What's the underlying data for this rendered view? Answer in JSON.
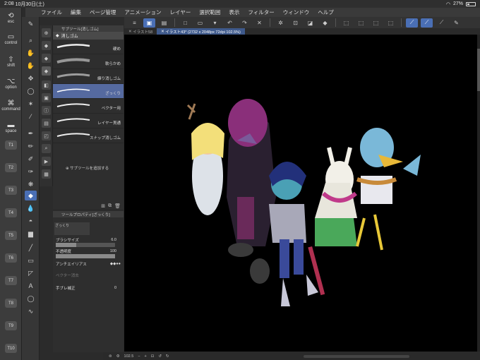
{
  "status": {
    "time": "2:08",
    "date": "10月30日(土)",
    "battery": "27%",
    "battery_level": 0.27
  },
  "menu": [
    "ファイル",
    "編集",
    "ページ管理",
    "アニメーション",
    "レイヤー",
    "選択範囲",
    "表示",
    "フィルター",
    "ウィンドウ",
    "ヘルプ"
  ],
  "edge": {
    "esc": "esc",
    "control": "control",
    "shift": "shift",
    "option": "option",
    "command": "command",
    "space": "space",
    "keys": [
      "T1",
      "T2",
      "T3",
      "T4",
      "T5",
      "T6",
      "T7",
      "T8",
      "T9",
      "T10"
    ]
  },
  "subtool": {
    "panel_title": "サブツール[消しゴム]",
    "group": "消しゴム",
    "items": [
      {
        "label": "硬め"
      },
      {
        "label": "軟らかめ"
      },
      {
        "label": "練り消しゴム"
      },
      {
        "label": "ざっくり"
      },
      {
        "label": "ベクター用"
      },
      {
        "label": "レイヤー貫通"
      },
      {
        "label": "スナップ消しゴム"
      }
    ],
    "add_label": "サブツールを追加する"
  },
  "property": {
    "panel_title": "ツールプロパティ[ざっくり]",
    "tool_name": "ざっくり",
    "brush_size_label": "ブラシサイズ",
    "brush_size": "6.0",
    "brush_size_fraction": 0.35,
    "opacity_label": "不透明度",
    "opacity": "100",
    "opacity_fraction": 1.0,
    "antialias_label": "アンチエイリアス",
    "vector_label": "ベクター消去",
    "stabilize_label": "手ブレ補正",
    "stabilize": "0"
  },
  "tabs": [
    "イラスト58",
    "イラスト43* (2732 x 2048px 72dpi 102.5%)"
  ],
  "zoom": "102.5",
  "colors": {
    "accent": "#4a6fb5",
    "canvas": "#000000",
    "panel": "#2e2e2e"
  }
}
